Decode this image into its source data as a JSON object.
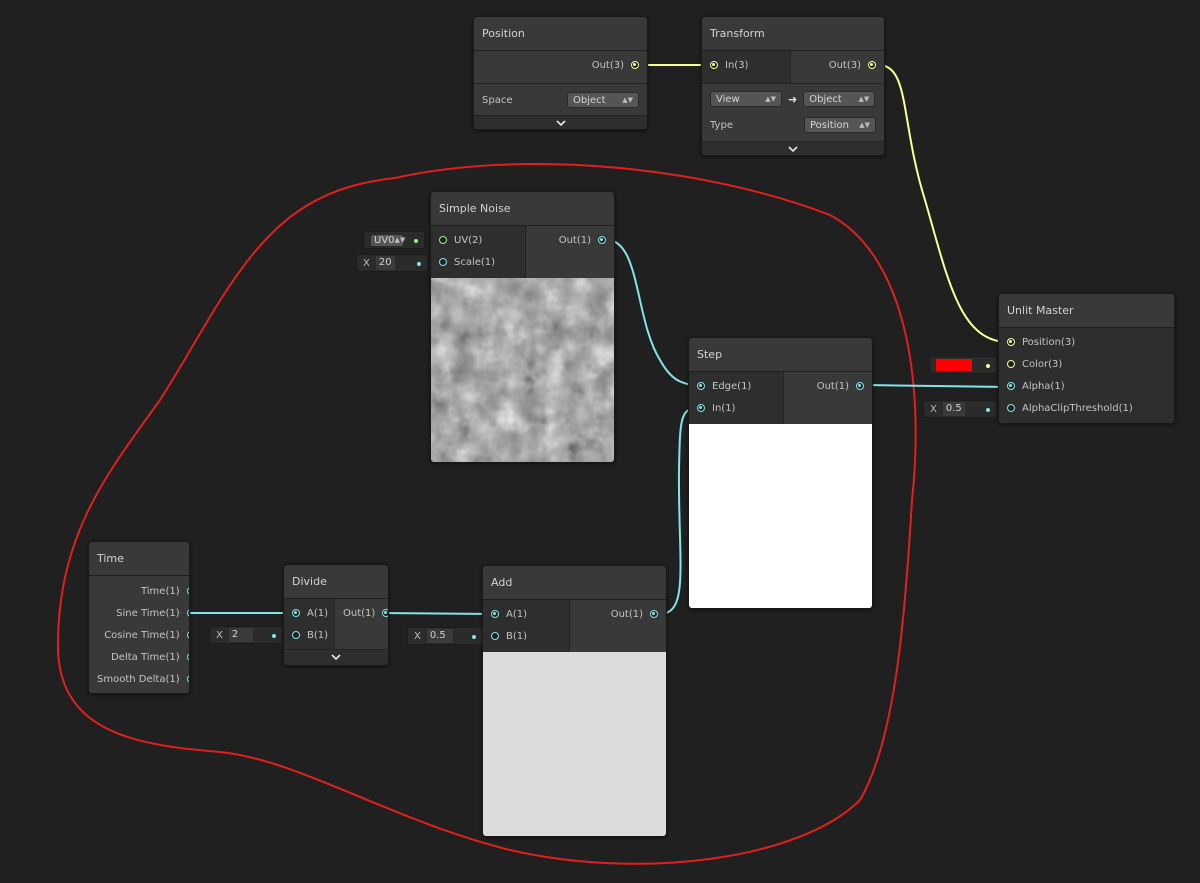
{
  "nodes": {
    "position": {
      "title": "Position",
      "out": "Out(3)",
      "space_label": "Space",
      "space_value": "Object"
    },
    "transform": {
      "title": "Transform",
      "in": "In(3)",
      "out": "Out(3)",
      "from_value": "View",
      "to_value": "Object",
      "type_label": "Type",
      "type_value": "Position"
    },
    "simple_noise": {
      "title": "Simple Noise",
      "in_uv": "UV(2)",
      "in_scale": "Scale(1)",
      "out": "Out(1)",
      "uv_value": "UV0",
      "scale_value": "20"
    },
    "step": {
      "title": "Step",
      "in_edge": "Edge(1)",
      "in_in": "In(1)",
      "out": "Out(1)"
    },
    "unlit_master": {
      "title": "Unlit Master",
      "in_position": "Position(3)",
      "in_color": "Color(3)",
      "in_alpha": "Alpha(1)",
      "in_clip": "AlphaClipThreshold(1)",
      "clip_value": "0.5",
      "color_swatch": "#ff0000"
    },
    "time": {
      "title": "Time",
      "outs": [
        "Time(1)",
        "Sine Time(1)",
        "Cosine Time(1)",
        "Delta Time(1)",
        "Smooth Delta(1)"
      ]
    },
    "divide": {
      "title": "Divide",
      "in_a": "A(1)",
      "in_b": "B(1)",
      "out": "Out(1)",
      "b_value": "2"
    },
    "add": {
      "title": "Add",
      "in_a": "A(1)",
      "in_b": "B(1)",
      "out": "Out(1)",
      "b_value": "0.5"
    }
  },
  "field_prefix": "X",
  "colors": {
    "background": "#202020",
    "node": "#393939",
    "float_wire": "#84e4e7",
    "vector3_wire": "#f6ff9a",
    "vector2_port": "#9aef92",
    "selection_outline": "#e0201e"
  }
}
